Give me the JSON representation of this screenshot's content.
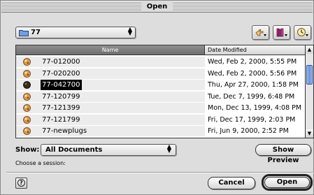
{
  "window": {
    "title": "Open"
  },
  "folder_popup": {
    "label": "77",
    "arrows": "⇕"
  },
  "toolbar": {
    "buttons": [
      {
        "name": "shortcuts",
        "icon": "shortcuts-hand-icon"
      },
      {
        "name": "favorites",
        "icon": "favorites-books-icon"
      },
      {
        "name": "recent",
        "icon": "recent-clock-icon"
      }
    ]
  },
  "list": {
    "columns": {
      "name": "Name",
      "date": "Date Modified"
    },
    "rows": [
      {
        "name": "77-012000",
        "date": "Wed, Feb 2, 2000, 5:55 PM",
        "selected": false
      },
      {
        "name": "77-020200",
        "date": "Wed, Feb 2, 2000, 5:56 PM",
        "selected": false
      },
      {
        "name": "77-042700",
        "date": "Thu, Apr 27, 2000, 1:58 PM",
        "selected": true
      },
      {
        "name": "77-120799",
        "date": "Tue, Dec 7, 1999, 6:48 PM",
        "selected": false
      },
      {
        "name": "77-121399",
        "date": "Mon, Dec 13, 1999, 4:08 PM",
        "selected": false
      },
      {
        "name": "77-121799",
        "date": "Fri, Dec 17, 1999, 2:03 PM",
        "selected": false
      },
      {
        "name": "77-newplugs",
        "date": "Fri, Jun 9, 2000, 2:52 PM",
        "selected": false
      }
    ],
    "scroll_up": "▲",
    "scroll_down": "▼"
  },
  "show": {
    "label": "Show:",
    "value": "All Documents"
  },
  "buttons": {
    "show_preview": "Show Preview",
    "cancel": "Cancel",
    "open": "Open",
    "help": "?"
  },
  "status": {
    "text": "Choose a session:"
  },
  "colors": {
    "selection": "#000000",
    "scroll_thumb": "#5e8fdc",
    "header_sorted": "#7a7a7a"
  }
}
